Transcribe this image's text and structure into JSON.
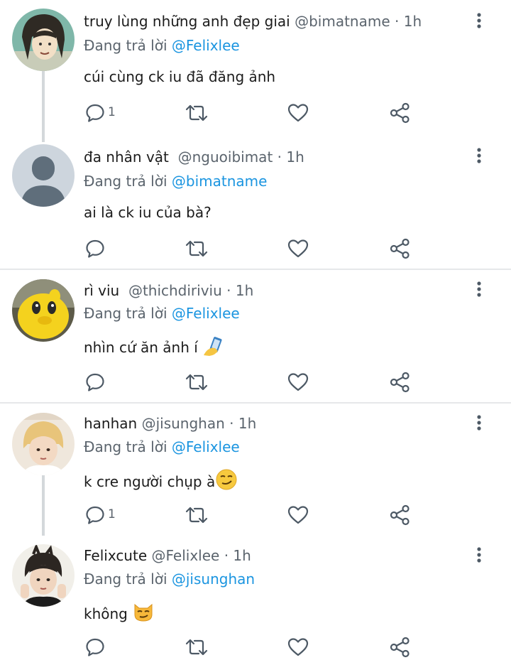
{
  "posts": [
    {
      "name": "truy lùng những anh đẹp giai",
      "handle": "@bimatname",
      "time": "· 1h",
      "reply_label": "Đang trả lời",
      "mention": "@Felixlee",
      "text": "cúi cùng ck iu đã đăng ảnh",
      "reply_count": "1",
      "avatar": "illustrated-girl-avatar"
    },
    {
      "name": "đa nhân vật",
      "handle": "@nguoibimat",
      "time": "· 1h",
      "reply_label": "Đang trả lời",
      "mention": "@bimatname",
      "text": "ai là ck iu của bà?",
      "reply_count": "",
      "avatar": "default-user-avatar"
    },
    {
      "name": "rì viu",
      "handle": "@thichdiriviu",
      "time": "· 1h",
      "reply_label": "Đang trả lời",
      "mention": "@Felixlee",
      "text": "nhìn cứ ăn ảnh í",
      "reply_count": "",
      "avatar": "yellow-duck-avatar"
    },
    {
      "name": "hanhan",
      "handle": "@jisunghan",
      "time": "· 1h",
      "reply_label": "Đang trả lời",
      "mention": "@Felixlee",
      "text": "k cre người chụp à",
      "reply_count": "1",
      "avatar": "blond-person-avatar"
    },
    {
      "name": "Felixcute",
      "handle": "@Felixlee",
      "time": "· 1h",
      "reply_label": "Đang trả lời",
      "mention": "@jisunghan",
      "text": "không",
      "reply_count": "",
      "avatar": "person-photo-avatar"
    }
  ],
  "icons": {
    "reply": "reply-bubble-icon",
    "retweet": "retweet-icon",
    "like": "heart-icon",
    "share": "share-icon",
    "more": "more-vertical-icon"
  },
  "colors": {
    "mention": "#1b95e0",
    "meta": "#5b646d",
    "icon": "#4d5965",
    "thread_line": "#d4d8db"
  }
}
